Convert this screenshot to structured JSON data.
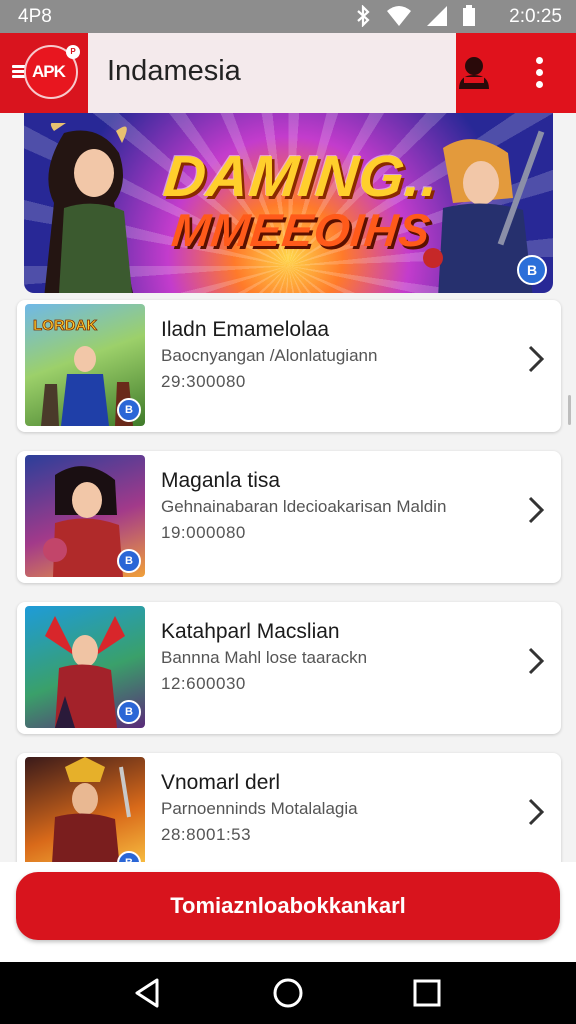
{
  "status_bar": {
    "time_left": "4P8",
    "time_right": "2:0:25",
    "icons": [
      "bluetooth-icon",
      "wifi-icon",
      "signal-icon",
      "battery-icon"
    ]
  },
  "app_bar": {
    "logo_text": "APK",
    "logo_badge": "P",
    "title": "Indamesia",
    "icons": [
      "menu-icon",
      "user-icon",
      "more-vert-icon"
    ]
  },
  "banner": {
    "line1": "DAMING..",
    "line2": "MMEEOIHS",
    "badge": "B"
  },
  "games": [
    {
      "name": "Iladn Emamelolaa",
      "desc": "Baocnyangan /Alonlatugiann",
      "meta": "29:300080"
    },
    {
      "name": "Maganla tisa",
      "desc": "Gehnainabaran ldecioakarisan Maldin",
      "meta": "19:000080"
    },
    {
      "name": "Katahparl Macslian",
      "desc": "Bannna Mahl lose taarackn",
      "meta": "12:600030"
    },
    {
      "name": "Vnomarl derl",
      "desc": "Parnoenninds Motalalagia",
      "meta": "28:8001:53"
    }
  ],
  "cta": {
    "label": "Tomiaznloabokkankarl"
  },
  "colors": {
    "brand_red": "#d9141e",
    "status_bar": "#8d8d8d",
    "nav_bar": "#000000"
  }
}
